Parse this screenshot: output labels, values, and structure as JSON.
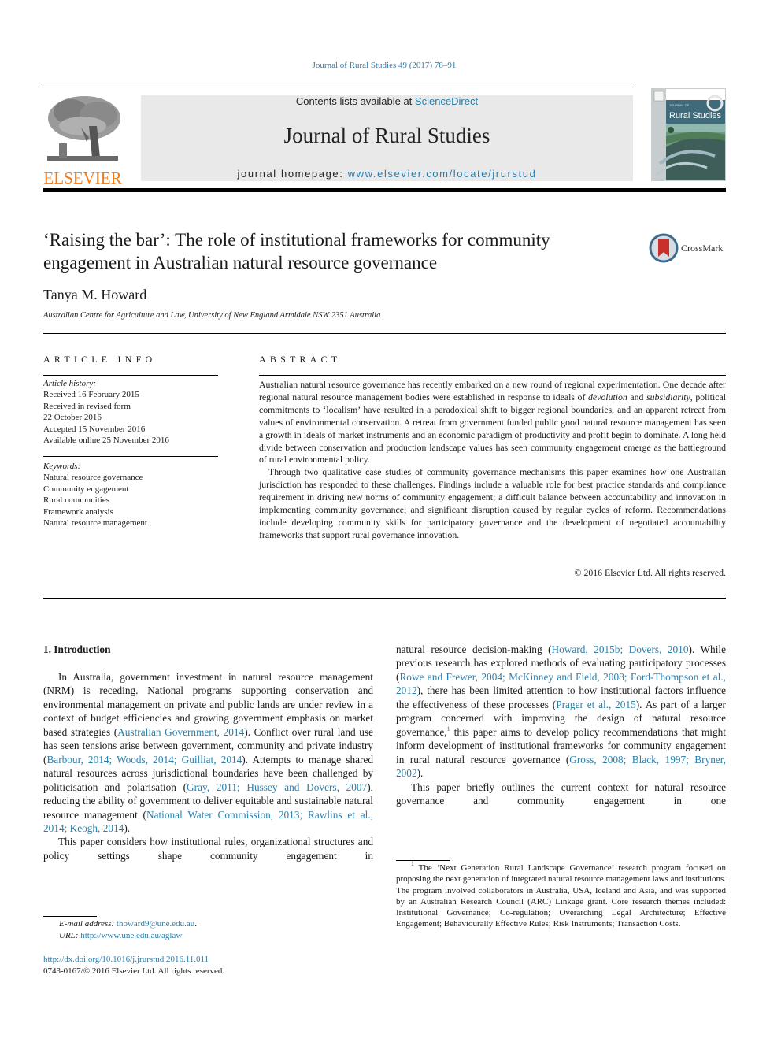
{
  "header": {
    "citation": "Journal of Rural Studies 49 (2017) 78–91",
    "contents_prefix": "Contents lists available at ",
    "contents_link": "ScienceDirect",
    "journal_title": "Journal of Rural Studies",
    "homepage_prefix": "journal homepage: ",
    "homepage_link": "www.elsevier.com/locate/jrurstud",
    "publisher_logo": "ELSEVIER",
    "cover_title": "Rural Studies",
    "cover_subtitle": "Journal of",
    "crossmark_label": "CrossMark",
    "colors": {
      "link": "#2a7fac",
      "elsevier_orange": "#f07a16",
      "masthead_bg": "#e9e9e9"
    }
  },
  "article": {
    "title": "‘Raising the bar’: The role of institutional frameworks for community engagement in Australian natural resource governance",
    "author": "Tanya M. Howard",
    "affiliation": "Australian Centre for Agriculture and Law, University of New England Armidale NSW 2351 Australia"
  },
  "article_info": {
    "heading": "ARTICLE INFO",
    "history_label": "Article history:",
    "history": [
      "Received 16 February 2015",
      "Received in revised form",
      "22 October 2016",
      "Accepted 15 November 2016",
      "Available online 25 November 2016"
    ],
    "keywords_label": "Keywords:",
    "keywords": [
      "Natural resource governance",
      "Community engagement",
      "Rural communities",
      "Framework analysis",
      "Natural resource management"
    ]
  },
  "abstract": {
    "heading": "ABSTRACT",
    "p1_a": "Australian natural resource governance has recently embarked on a new round of regional experimentation. One decade after regional natural resource management bodies were established in response to ideals of ",
    "p1_em1": "devolution",
    "p1_b": " and ",
    "p1_em2": "subsidiarity",
    "p1_c": ", political commitments to ‘localism’ have resulted in a paradoxical shift to bigger regional boundaries, and an apparent retreat from values of environmental conservation. A retreat from government funded public good natural resource management has seen a growth in ideals of market instruments and an economic paradigm of productivity and profit begin to dominate. A long held divide between conservation and production landscape values has seen community engagement emerge as the battleground of rural environmental policy.",
    "p2": "Through two qualitative case studies of community governance mechanisms this paper examines how one Australian jurisdiction has responded to these challenges. Findings include a valuable role for best practice standards and compliance requirement in driving new norms of community engagement; a difficult balance between accountability and innovation in implementing community governance; and significant disruption caused by regular cycles of reform. Recommendations include developing community skills for participatory governance and the development of negotiated accountability frameworks that support rural governance innovation.",
    "copyright": "© 2016 Elsevier Ltd. All rights reserved."
  },
  "body": {
    "section_heading": "1.  Introduction",
    "left": {
      "p1_a": "In Australia, government investment in natural resource management (NRM) is receding. National programs supporting conservation and environmental management on private and public lands are under review in a context of budget efficiencies and growing government emphasis on market based strategies (",
      "p1_ref1": "Australian Government, 2014",
      "p1_b": "). Conflict over rural land use has seen tensions arise between government, community and private industry (",
      "p1_ref2": "Barbour, 2014; Woods, 2014; Guilliat, 2014",
      "p1_c": "). Attempts to manage shared natural resources across jurisdictional boundaries have been challenged by politicisation and polarisation (",
      "p1_ref3": "Gray, 2011; Hussey and Dovers, 2007",
      "p1_d": "), reducing the ability of government to deliver equitable and sustainable natural resource management (",
      "p1_ref4": "National Water Commission, 2013; Rawlins et al., 2014; Keogh, 2014",
      "p1_e": ").",
      "p2": "This paper considers how institutional rules, organizational structures and policy settings shape community engagement in"
    },
    "right": {
      "p1_a": "natural resource decision-making (",
      "p1_ref1": "Howard, 2015b; Dovers, 2010",
      "p1_b": "). While previous research has explored methods of evaluating participatory processes (",
      "p1_ref2": "Rowe and Frewer, 2004; McKinney and Field, 2008; Ford-Thompson et al., 2012",
      "p1_c": "), there has been limited attention to how institutional factors influence the effectiveness of these processes (",
      "p1_ref3": "Prager et al., 2015",
      "p1_d": "). As part of a larger program concerned with improving the design of natural resource governance,",
      "p1_fnmark": "1",
      "p1_e": " this paper aims to develop policy recommendations that might inform development of institutional frameworks for community engagement in rural natural resource governance (",
      "p1_ref4": "Gross, 2008; Black, 1997; Bryner, 2002",
      "p1_f": ").",
      "p2": "This paper briefly outlines the current context for natural resource governance and community engagement in one"
    }
  },
  "footnotes": {
    "email_label": "E-mail address: ",
    "email": "thoward9@une.edu.au",
    "email_suffix": ".",
    "url_label": "URL: ",
    "url": "http://www.une.edu.au/aglaw",
    "doi": "http://dx.doi.org/10.1016/j.jrurstud.2016.11.011",
    "issn": "0743-0167/© 2016 Elsevier Ltd. All rights reserved.",
    "fn1_mark": "1",
    "fn1_text": " The ‘Next Generation Rural Landscape Governance’ research program focused on proposing the next generation of integrated natural resource management laws and institutions. The program involved collaborators in Australia, USA, Iceland and Asia, and was supported by an Australian Research Council (ARC) Linkage grant. Core research themes included: Institutional Governance; Co-regulation; Overarching Legal Architecture; Effective Engagement; Behaviourally Effective Rules; Risk Instruments; Transaction Costs."
  }
}
